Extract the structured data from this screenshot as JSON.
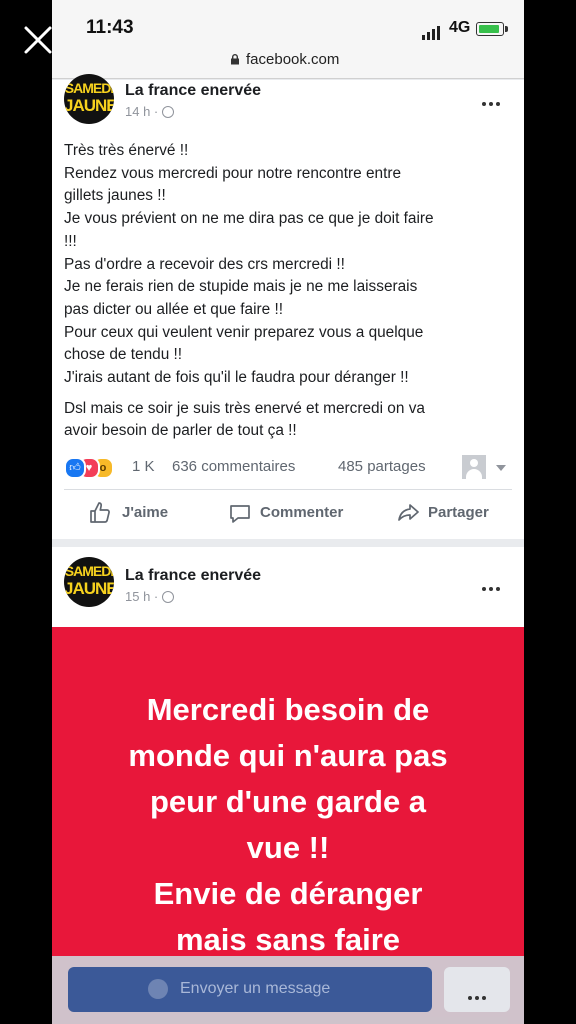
{
  "status_bar": {
    "time": "11:43",
    "network": "4G"
  },
  "browser": {
    "url": "facebook.com"
  },
  "posts": [
    {
      "avatar": {
        "line1": "SAMEDI",
        "line2": "JAUNE"
      },
      "page_name": "La france enervée",
      "time": "14 h ·",
      "text_lines": [
        "Très très énervé !!",
        "Rendez vous mercredi pour notre rencontre entre",
        "gillets jaunes !!",
        "Je vous prévient on ne me dira pas ce que je doit faire",
        "!!!",
        "Pas d'ordre a recevoir des crs mercredi !!",
        "Je ne ferais rien de stupide mais je ne me laisserais",
        "pas dicter ou allée et que faire !!",
        "Pour ceux qui veulent venir preparez vous a quelque",
        "chose de tendu !!",
        "J'irais autant de fois qu'il le faudra pour déranger !!"
      ],
      "text_lines_2": [
        "Dsl mais ce soir je suis très enervé et mercredi on va",
        "avoir besoin de parler de tout ça !!"
      ],
      "reactions_count": "1 K",
      "comments": "636 commentaires",
      "shares": "485 partages",
      "actions": {
        "like": "J'aime",
        "comment": "Commenter",
        "share": "Partager"
      }
    },
    {
      "avatar": {
        "line1": "SAMEDI",
        "line2": "JAUNE"
      },
      "page_name": "La france enervée",
      "time": "15 h ·",
      "banner_lines": [
        "Mercredi besoin de",
        "monde qui n'aura pas",
        "peur d'une garde a",
        "vue !!",
        "Envie de déranger",
        "mais sans faire"
      ]
    }
  ],
  "message_bar": {
    "button_label": "Envoyer un message"
  },
  "colors": {
    "brand_blue": "#3b5998",
    "banner_red": "#e8173a",
    "like_blue": "#1877f2",
    "love_red": "#f33e58",
    "wow_yellow": "#f7b928"
  }
}
